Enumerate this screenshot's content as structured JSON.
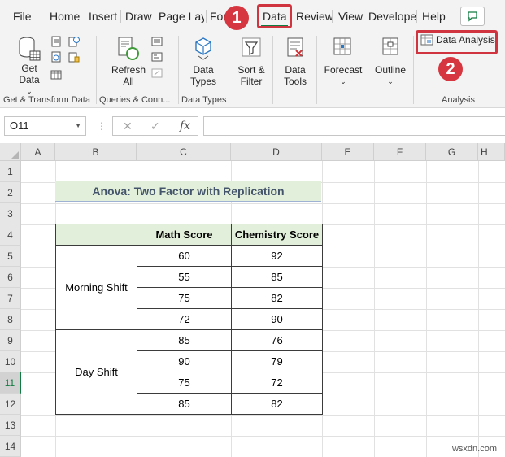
{
  "menu": {
    "tabs": [
      "File",
      "Home",
      "Insert",
      "Draw",
      "Page Layo",
      "For",
      "Data",
      "Review",
      "View",
      "Develope",
      "Help"
    ],
    "active_tab": "Data"
  },
  "callouts": {
    "step1": "1",
    "step2": "2"
  },
  "ribbon": {
    "get_data": "Get Data",
    "refresh_all": "Refresh All",
    "data_types": "Data Types",
    "sort_filter": "Sort & Filter",
    "data_tools": "Data Tools",
    "forecast": "Forecast",
    "outline": "Outline",
    "data_analysis": "Data Analysis",
    "groups": [
      "Get & Transform Data",
      "Queries & Conn...",
      "Data Types",
      "Analysis"
    ]
  },
  "formula_bar": {
    "name_box": "O11",
    "fx": "fx",
    "formula": ""
  },
  "sheet": {
    "columns": [
      "A",
      "B",
      "C",
      "D",
      "E",
      "F",
      "G",
      "H"
    ],
    "rows": [
      "1",
      "2",
      "3",
      "4",
      "5",
      "6",
      "7",
      "8",
      "9",
      "10",
      "11",
      "12",
      "13",
      "14"
    ],
    "selected_row": "11",
    "title": "Anova: Two Factor with Replication",
    "headers": [
      "",
      "Math Score",
      "Chemistry Score"
    ],
    "groups": [
      {
        "label": "Morning Shift",
        "rows": [
          [
            "60",
            "92"
          ],
          [
            "55",
            "85"
          ],
          [
            "75",
            "82"
          ],
          [
            "72",
            "90"
          ]
        ]
      },
      {
        "label": "Day Shift",
        "rows": [
          [
            "85",
            "76"
          ],
          [
            "90",
            "79"
          ],
          [
            "75",
            "72"
          ],
          [
            "85",
            "82"
          ]
        ]
      }
    ]
  },
  "watermark": "wsxdn.com",
  "colors": {
    "accent_green": "#107c41",
    "callout_red": "#d6363f",
    "header_fill": "#e2efda",
    "title_text": "#44546a"
  }
}
